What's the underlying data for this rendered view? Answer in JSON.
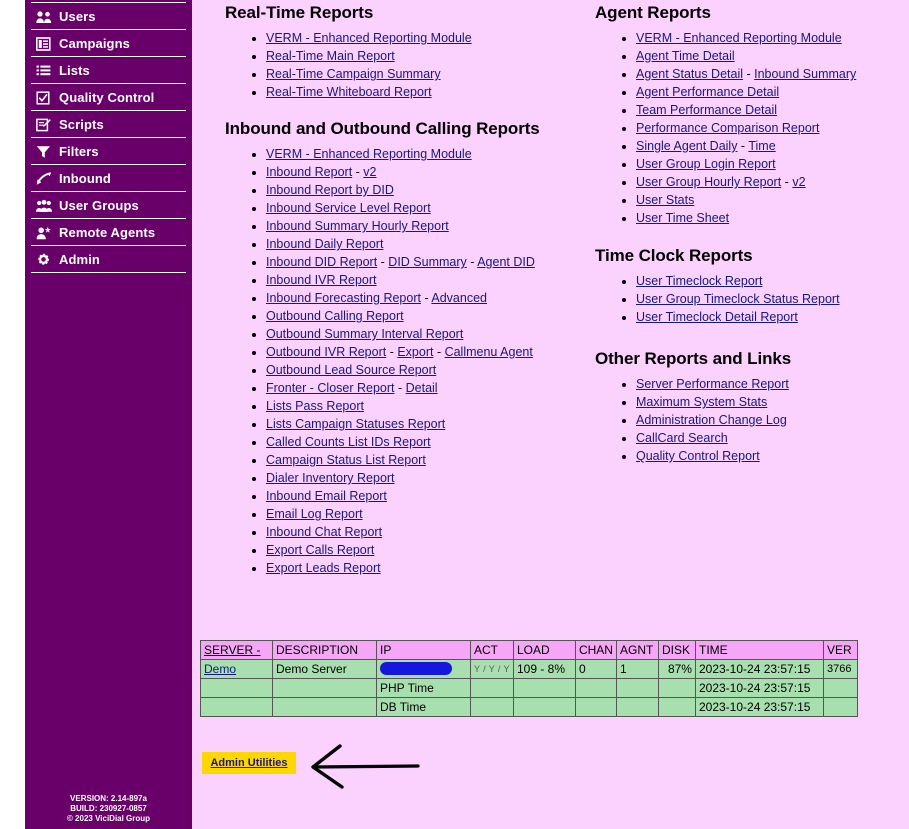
{
  "sidebar": {
    "items": [
      {
        "label": "Users",
        "icon": "users-icon"
      },
      {
        "label": "Campaigns",
        "icon": "campaigns-icon"
      },
      {
        "label": "Lists",
        "icon": "lists-icon"
      },
      {
        "label": "Quality Control",
        "icon": "checkbox-icon"
      },
      {
        "label": "Scripts",
        "icon": "script-edit-icon"
      },
      {
        "label": "Filters",
        "icon": "funnel-icon"
      },
      {
        "label": "Inbound",
        "icon": "inbound-arrow-icon"
      },
      {
        "label": "User Groups",
        "icon": "user-groups-icon"
      },
      {
        "label": "Remote Agents",
        "icon": "remote-agent-icon"
      },
      {
        "label": "Admin",
        "icon": "gear-icon"
      }
    ],
    "footer": {
      "version": "VERSION: 2.14-897a",
      "build": "BUILD: 230927-0857",
      "copyright": "© 2023 ViciDial Group"
    }
  },
  "sections": {
    "realtime": {
      "title": "Real-Time Reports",
      "links": [
        [
          {
            "t": "VERM - Enhanced Reporting Module",
            "link": true
          }
        ],
        [
          {
            "t": "Real-Time Main Report",
            "link": true
          }
        ],
        [
          {
            "t": "Real-Time Campaign Summary",
            "link": true
          }
        ],
        [
          {
            "t": "Real-Time Whiteboard Report",
            "link": true
          }
        ]
      ]
    },
    "inout": {
      "title": "Inbound and Outbound Calling Reports",
      "links": [
        [
          {
            "t": "VERM - Enhanced Reporting Module",
            "link": true
          }
        ],
        [
          {
            "t": "Inbound Report",
            "link": true
          },
          {
            "t": " - ",
            "link": false
          },
          {
            "t": "v2",
            "link": true
          }
        ],
        [
          {
            "t": "Inbound Report by DID",
            "link": true
          }
        ],
        [
          {
            "t": "Inbound Service Level Report",
            "link": true
          }
        ],
        [
          {
            "t": "Inbound Summary Hourly Report",
            "link": true
          }
        ],
        [
          {
            "t": "Inbound Daily Report",
            "link": true
          }
        ],
        [
          {
            "t": "Inbound DID Report",
            "link": true
          },
          {
            "t": " - ",
            "link": false
          },
          {
            "t": "DID Summary",
            "link": true
          },
          {
            "t": " - ",
            "link": false
          },
          {
            "t": "Agent DID",
            "link": true
          }
        ],
        [
          {
            "t": "Inbound IVR Report",
            "link": true
          }
        ],
        [
          {
            "t": "Inbound Forecasting Report",
            "link": true
          },
          {
            "t": " - ",
            "link": false
          },
          {
            "t": "Advanced",
            "link": true
          }
        ],
        [
          {
            "t": "Outbound Calling Report",
            "link": true
          }
        ],
        [
          {
            "t": "Outbound Summary Interval Report",
            "link": true
          }
        ],
        [
          {
            "t": "Outbound IVR Report",
            "link": true
          },
          {
            "t": " - ",
            "link": false
          },
          {
            "t": "Export",
            "link": true
          },
          {
            "t": " - ",
            "link": false
          },
          {
            "t": "Callmenu Agent",
            "link": true
          }
        ],
        [
          {
            "t": "Outbound Lead Source Report",
            "link": true
          }
        ],
        [
          {
            "t": "Fronter - Closer Report",
            "link": true
          },
          {
            "t": " - ",
            "link": false
          },
          {
            "t": "Detail",
            "link": true
          }
        ],
        [
          {
            "t": "Lists Pass Report",
            "link": true
          }
        ],
        [
          {
            "t": "Lists Campaign Statuses Report",
            "link": true
          }
        ],
        [
          {
            "t": "Called Counts List IDs Report",
            "link": true
          }
        ],
        [
          {
            "t": "Campaign Status List Report",
            "link": true
          }
        ],
        [
          {
            "t": "Dialer Inventory Report",
            "link": true
          }
        ],
        [
          {
            "t": "Inbound Email Report",
            "link": true
          }
        ],
        [
          {
            "t": "Email Log Report",
            "link": true
          }
        ],
        [
          {
            "t": "Inbound Chat Report",
            "link": true
          }
        ],
        [
          {
            "t": "Export Calls Report",
            "link": true
          }
        ],
        [
          {
            "t": "Export Leads Report",
            "link": true
          }
        ]
      ]
    },
    "agent": {
      "title": "Agent Reports",
      "links": [
        [
          {
            "t": "VERM - Enhanced Reporting Module",
            "link": true
          }
        ],
        [
          {
            "t": "Agent Time Detail",
            "link": true
          }
        ],
        [
          {
            "t": "Agent Status Detail",
            "link": true
          },
          {
            "t": " - ",
            "link": false
          },
          {
            "t": "Inbound Summary",
            "link": true
          }
        ],
        [
          {
            "t": "Agent Performance Detail",
            "link": true
          }
        ],
        [
          {
            "t": "Team Performance Detail",
            "link": true
          }
        ],
        [
          {
            "t": "Performance Comparison Report",
            "link": true
          }
        ],
        [
          {
            "t": "Single Agent Daily",
            "link": true
          },
          {
            "t": " - ",
            "link": false
          },
          {
            "t": "Time",
            "link": true
          }
        ],
        [
          {
            "t": "User Group Login Report",
            "link": true
          }
        ],
        [
          {
            "t": "User Group Hourly Report",
            "link": true
          },
          {
            "t": " - ",
            "link": false
          },
          {
            "t": "v2",
            "link": true
          }
        ],
        [
          {
            "t": "User Stats",
            "link": true
          }
        ],
        [
          {
            "t": "User Time Sheet",
            "link": true
          }
        ]
      ]
    },
    "timeclock": {
      "title": "Time Clock Reports",
      "links": [
        [
          {
            "t": "User Timeclock Report",
            "link": true
          }
        ],
        [
          {
            "t": "User Group Timeclock Status Report",
            "link": true
          }
        ],
        [
          {
            "t": "User Timeclock Detail Report",
            "link": true
          }
        ]
      ]
    },
    "other": {
      "title": "Other Reports and Links",
      "links": [
        [
          {
            "t": "Server Performance Report",
            "link": true
          }
        ],
        [
          {
            "t": "Maximum System Stats",
            "link": true
          }
        ],
        [
          {
            "t": "Administration Change Log",
            "link": true
          }
        ],
        [
          {
            "t": "CallCard Search",
            "link": true
          }
        ],
        [
          {
            "t": "Quality Control Report",
            "link": true
          }
        ]
      ]
    }
  },
  "server_table": {
    "headers": [
      "SERVER -",
      "DESCRIPTION",
      "IP",
      "ACT",
      "LOAD",
      "CHAN",
      "AGNT",
      "DISK",
      "TIME",
      "VER"
    ],
    "rows": [
      {
        "server": "Demo",
        "description": "Demo Server",
        "ip": "",
        "ip_redacted": true,
        "act": "Y / Y / Y",
        "load": "109 - 8%",
        "chan": "0",
        "agnt": "1",
        "disk": "87%",
        "time": "2023-10-24 23:57:15",
        "ver": "3766"
      },
      {
        "server": "",
        "description": "",
        "ip": "PHP Time",
        "ip_redacted": false,
        "act": "",
        "load": "",
        "chan": "",
        "agnt": "",
        "disk": "",
        "time": "2023-10-24 23:57:15",
        "ver": ""
      },
      {
        "server": "",
        "description": "",
        "ip": "DB Time",
        "ip_redacted": false,
        "act": "",
        "load": "",
        "chan": "",
        "agnt": "",
        "disk": "",
        "time": "2023-10-24 23:57:15",
        "ver": ""
      }
    ]
  },
  "admin_utilities": {
    "label": "Admin Utilities",
    "highlight_color": "#ffd700",
    "annotation": "arrow-pointing-left-at-admin-utilities"
  },
  "colors": {
    "sidebar": "#690069",
    "page_background": "#fbd2fd",
    "link": "#16187d",
    "table_header": "#f6a6f6",
    "table_cell": "#a8dfae",
    "redaction": "#1616dd"
  }
}
